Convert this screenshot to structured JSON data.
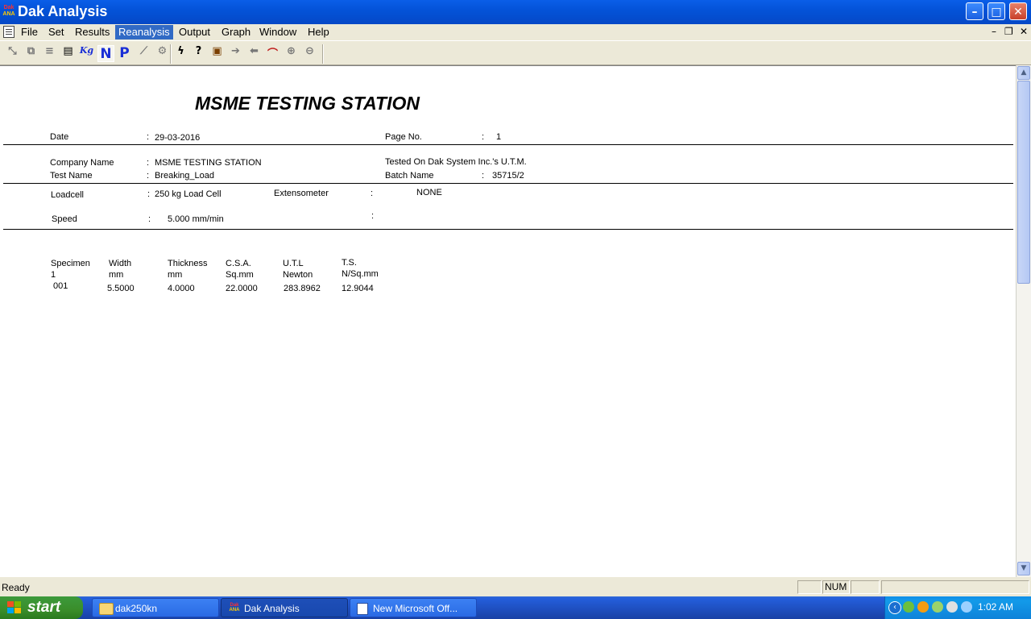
{
  "window": {
    "title": "Dak Analysis",
    "logo_top": "Dak",
    "logo_bottom": "ANA",
    "minimize": "–",
    "maximize": "□",
    "close": "✕"
  },
  "menu": {
    "items": [
      "File",
      "Set",
      "Results",
      "Reanalysis",
      "Output",
      "Graph",
      "Window",
      "Help"
    ],
    "active": "Reanalysis",
    "mdi_minimize": "–",
    "mdi_restore": "❐",
    "mdi_close": "✕"
  },
  "toolbar": {
    "kg_label": "Kg",
    "n_label": "N",
    "p_label": "P"
  },
  "report": {
    "title": "MSME TESTING STATION",
    "date_label": "Date",
    "date_value": "29-03-2016",
    "page_label": "Page No.",
    "page_value": "1",
    "company_label": "Company Name",
    "company_value": "MSME TESTING STATION",
    "tested_on": "Tested On Dak System Inc.'s U.T.M.",
    "test_name_label": "Test Name",
    "test_name_value": "Breaking_Load",
    "batch_label": "Batch Name",
    "batch_value": "35715/2",
    "loadcell_label": "Loadcell",
    "loadcell_value": "250 kg Load Cell",
    "extenso_label": "Extensometer",
    "extenso_value": "NONE",
    "speed_label": "Speed",
    "speed_value": "5.000 mm/min",
    "colon": ":",
    "columns": [
      {
        "name": "Specimen",
        "unit": "1"
      },
      {
        "name": "Width",
        "unit": "mm"
      },
      {
        "name": "Thickness",
        "unit": "mm"
      },
      {
        "name": "C.S.A.",
        "unit": "Sq.mm"
      },
      {
        "name": "U.T.L",
        "unit": "Newton"
      },
      {
        "name": "T.S.",
        "unit": "N/Sq.mm"
      }
    ],
    "rows": [
      [
        "001",
        "5.5000",
        "4.0000",
        "22.0000",
        "283.8962",
        "12.9044"
      ]
    ]
  },
  "scrollbar": {
    "up": "▲",
    "down": "▼"
  },
  "status": {
    "text": "Ready",
    "num": "NUM"
  },
  "taskbar": {
    "start": "start",
    "tasks": [
      {
        "label": "dak250kn",
        "icon": "folder-icon"
      },
      {
        "label": "Dak Analysis",
        "icon": "dak-app-icon"
      },
      {
        "label": "New Microsoft Off...",
        "icon": "word-doc-icon"
      }
    ],
    "clock": "1:02 AM",
    "tray_expand": "‹"
  }
}
